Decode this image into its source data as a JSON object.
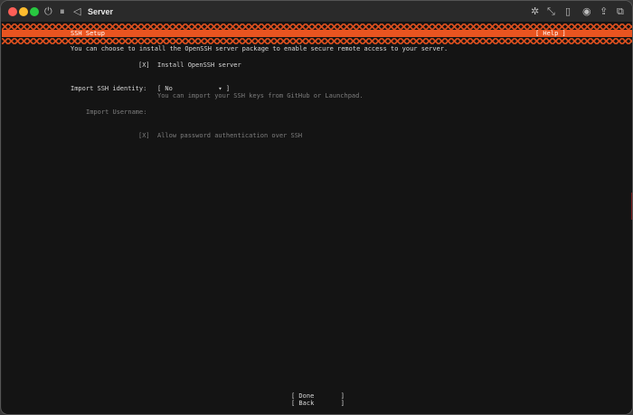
{
  "window": {
    "title": "Server"
  },
  "header": {
    "title": "SSH Setup",
    "help_label": "[ Help ]"
  },
  "body": {
    "intro": "You can choose to install the OpenSSH server package to enable secure remote access to your server.",
    "install_checkbox": "[X]",
    "install_label": "Install OpenSSH server",
    "import_identity_label": "Import SSH identity:",
    "import_identity_value": "[ No            ▾ ]",
    "import_identity_hint": "You can import your SSH keys from GitHub or Launchpad.",
    "import_username_label": "Import Username:",
    "password_checkbox": "[X]",
    "password_label": "Allow password authentication over SSH"
  },
  "footer": {
    "done_label": "[ Done       ]",
    "back_label": "[ Back       ]"
  },
  "colors": {
    "accent": "#e95420",
    "terminal_bg": "#141414",
    "text": "#d8d8d8",
    "dim_text": "#7d7d7d"
  }
}
